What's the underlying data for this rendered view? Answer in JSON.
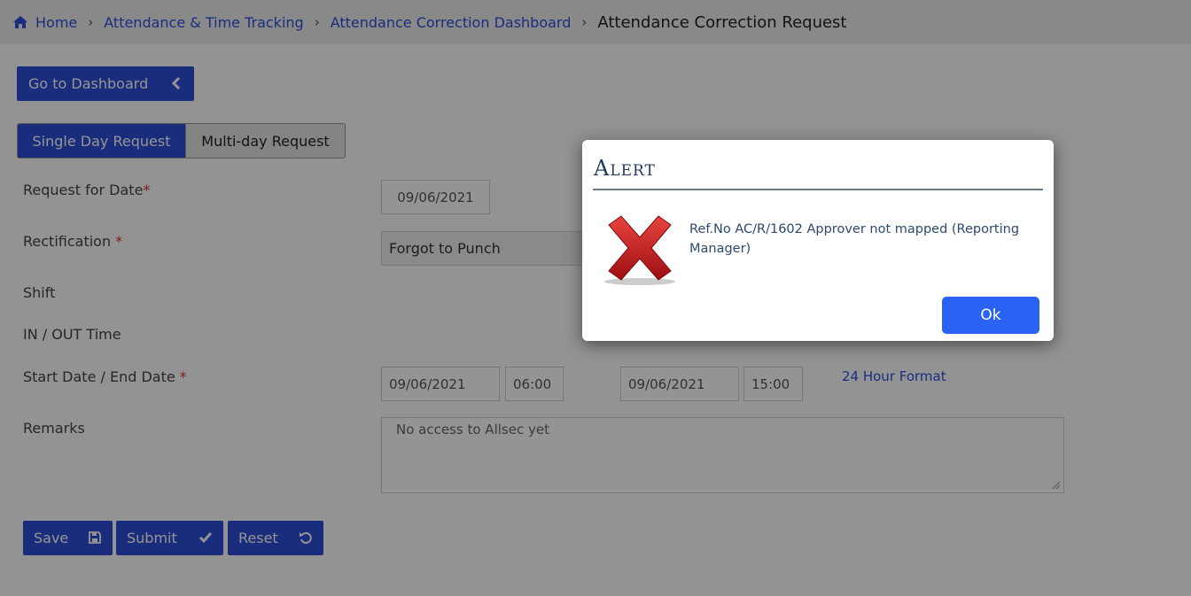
{
  "breadcrumb": {
    "home": "Home",
    "item1": "Attendance & Time Tracking",
    "item2": "Attendance Correction Dashboard",
    "current": "Attendance Correction Request",
    "separator": "›"
  },
  "buttons": {
    "go_dashboard": "Go to Dashboard",
    "save": "Save",
    "submit": "Submit",
    "reset": "Reset"
  },
  "request_type": {
    "single": "Single Day Request",
    "multi": "Multi-day Request",
    "selected": "Single Day Request"
  },
  "form": {
    "request_date_label": "Request for Date",
    "request_date_value": "09/06/2021",
    "rectification_label": "Rectification ",
    "rectification_value": "Forgot to Punch",
    "shift_label": "Shift",
    "inout_label": "IN / OUT Time",
    "startend_label": "Start Date / End Date ",
    "start_date": "09/06/2021",
    "start_time": "06:00",
    "end_date": "09/06/2021",
    "end_time": "15:00",
    "format_link": "24 Hour Format",
    "remarks_label": "Remarks",
    "remarks_value": "No access to Allsec yet",
    "required_mark": "*"
  },
  "alert": {
    "title": "Alert",
    "message": "Ref.No AC/R/1602 Approver not mapped (Reporting Manager)",
    "ok": "Ok"
  },
  "colors": {
    "primary": "#2e4fd8",
    "link": "#2d4fd9",
    "ok_button": "#2a62f3",
    "required": "#e0302a",
    "error_icon": "#c8171b"
  }
}
